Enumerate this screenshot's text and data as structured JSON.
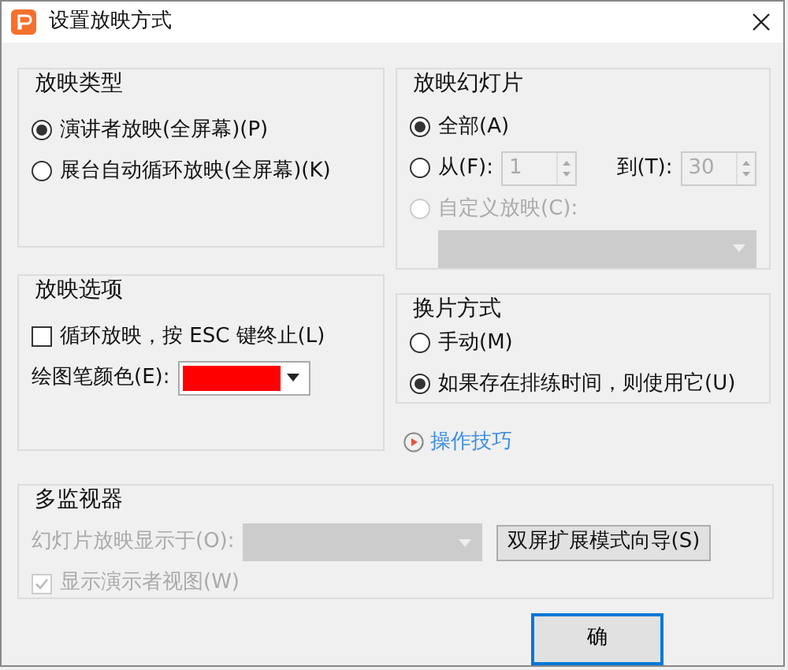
{
  "window": {
    "title": "设置放映方式"
  },
  "show_type": {
    "title": "放映类型",
    "options": [
      {
        "label": "演讲者放映(全屏幕)(P)",
        "selected": true
      },
      {
        "label": "展台自动循环放映(全屏幕)(K)",
        "selected": false
      }
    ]
  },
  "show_options": {
    "title": "放映选项",
    "loop": {
      "label": "循环放映，按 ESC 键终止(L)",
      "checked": false
    },
    "pen_color": {
      "label": "绘图笔颜色(E):",
      "color": "#ff0000"
    }
  },
  "slides": {
    "title": "放映幻灯片",
    "options": [
      {
        "kind": "all",
        "label": "全部(A)",
        "selected": true,
        "disabled": false
      },
      {
        "kind": "range",
        "label": "从(F):",
        "selected": false,
        "disabled": false,
        "from": "1",
        "to_label": "到(T):",
        "to": "30"
      },
      {
        "kind": "custom",
        "label": "自定义放映(C):",
        "selected": false,
        "disabled": true
      }
    ]
  },
  "advance": {
    "title": "换片方式",
    "options": [
      {
        "label": "手动(M)",
        "selected": false
      },
      {
        "label": "如果存在排练时间，则使用它(U)",
        "selected": true
      }
    ]
  },
  "tips_link": "操作技巧",
  "monitors": {
    "title": "多监视器",
    "display_label": "幻灯片放映显示于(O):",
    "disabled": true,
    "wizard_button": "双屏扩展模式向导(S)",
    "presenter_view": {
      "label": "显示演示者视图(W)",
      "checked": true,
      "disabled": true
    }
  },
  "buttons": [
    {
      "label": "确",
      "default": true
    }
  ]
}
